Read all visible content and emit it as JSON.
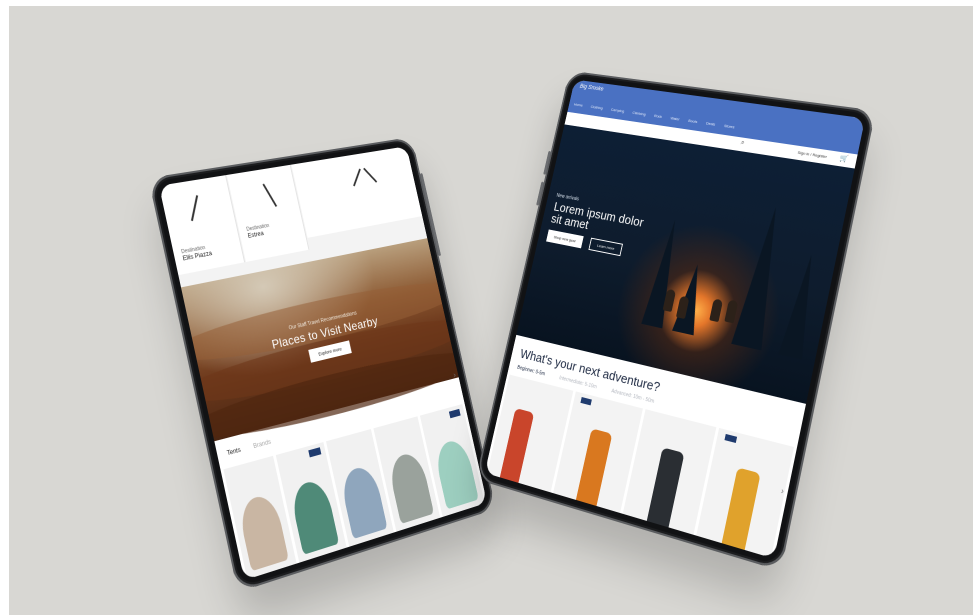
{
  "left_tablet": {
    "hero": {
      "eyebrow": "Our Staff Travel Recommendations",
      "title": "Places to Visit Nearby",
      "button_label": "Explore more"
    },
    "tile_captions": [
      "Destination",
      "Ellis Piazza",
      "Destination",
      "Estrea"
    ],
    "tabs": [
      "Tents",
      "Brands"
    ],
    "product_colors": [
      "#c9b6a3",
      "#4f8a78",
      "#8fa6bd",
      "#9aa29c",
      "#9dcfc0"
    ]
  },
  "right_tablet": {
    "logo_text": "Big Smoke",
    "nav_items": [
      "Home",
      "Clothing",
      "Camping",
      "Climbing",
      "Rock",
      "Water",
      "Boots",
      "Deals",
      "Stores"
    ],
    "account_label": "Sign in / Register",
    "hero": {
      "eyebrow": "New arrivals",
      "title": "Lorem ipsum dolor sit amet",
      "primary_button": "Shop new gear",
      "secondary_button": "Learn more"
    },
    "section_title": "What's your next adventure?",
    "levels": [
      "Beginner: 0-5m",
      "Intermediate: 5-10m",
      "Advanced: 10m - 50m"
    ],
    "product_colors": [
      "#c9452b",
      "#d9781f",
      "#2a2e33",
      "#e0a22c"
    ]
  },
  "colors": {
    "background": "#d8d7d3",
    "brand_blue": "#4a71c2",
    "navy_badge": "#1f3b6e"
  }
}
